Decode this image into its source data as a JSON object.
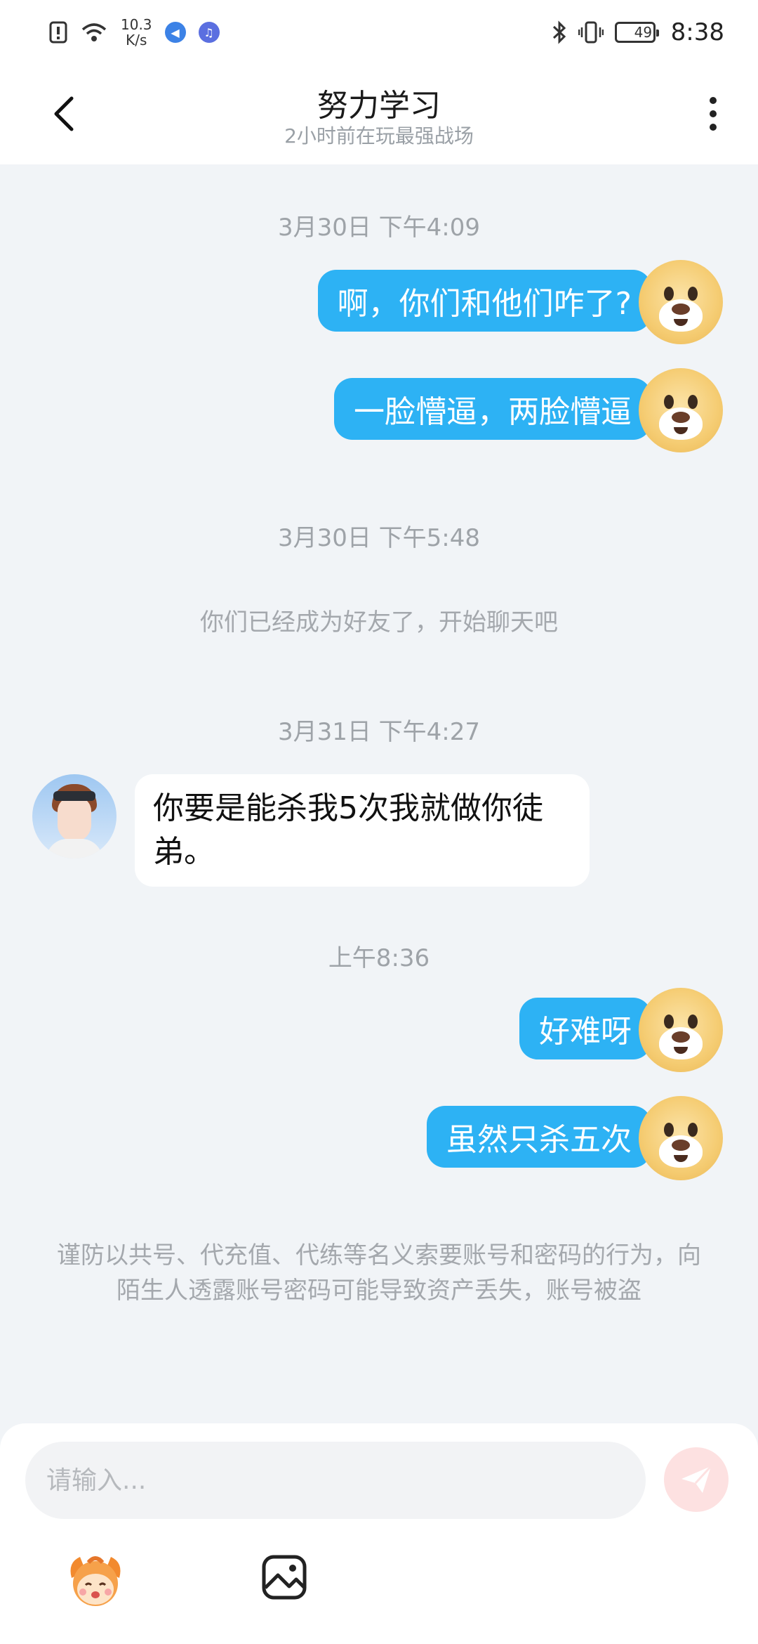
{
  "status_bar": {
    "net_speed_value": "10.3",
    "net_speed_unit": "K/s",
    "battery": "49",
    "battery_level": 0.49,
    "time": "8:38"
  },
  "header": {
    "title": "努力学习",
    "subtitle": "2小时前在玩最强战场"
  },
  "messages": {
    "ts1": "3月30日 下午4:09",
    "out1": "啊，你们和他们咋了?",
    "out2": "一脸懵逼，两脸懵逼",
    "ts2": "3月30日 下午5:48",
    "sys1": "你们已经成为好友了，开始聊天吧",
    "ts3": "3月31日 下午4:27",
    "in1": "你要是能杀我5次我就做你徒弟。",
    "ts4": "上午8:36",
    "out3": "好难呀",
    "out4": "虽然只杀五次",
    "warning": "谨防以共号、代充值、代练等名义索要账号和密码的行为，向陌生人透露账号密码可能导致资产丢失，账号被盗"
  },
  "input": {
    "placeholder": "请输入..."
  },
  "colors": {
    "bubble_out": "#2db2f4",
    "bubble_in": "#ffffff",
    "chat_bg": "#f1f4f7",
    "send_disabled": "#fde1e1"
  }
}
